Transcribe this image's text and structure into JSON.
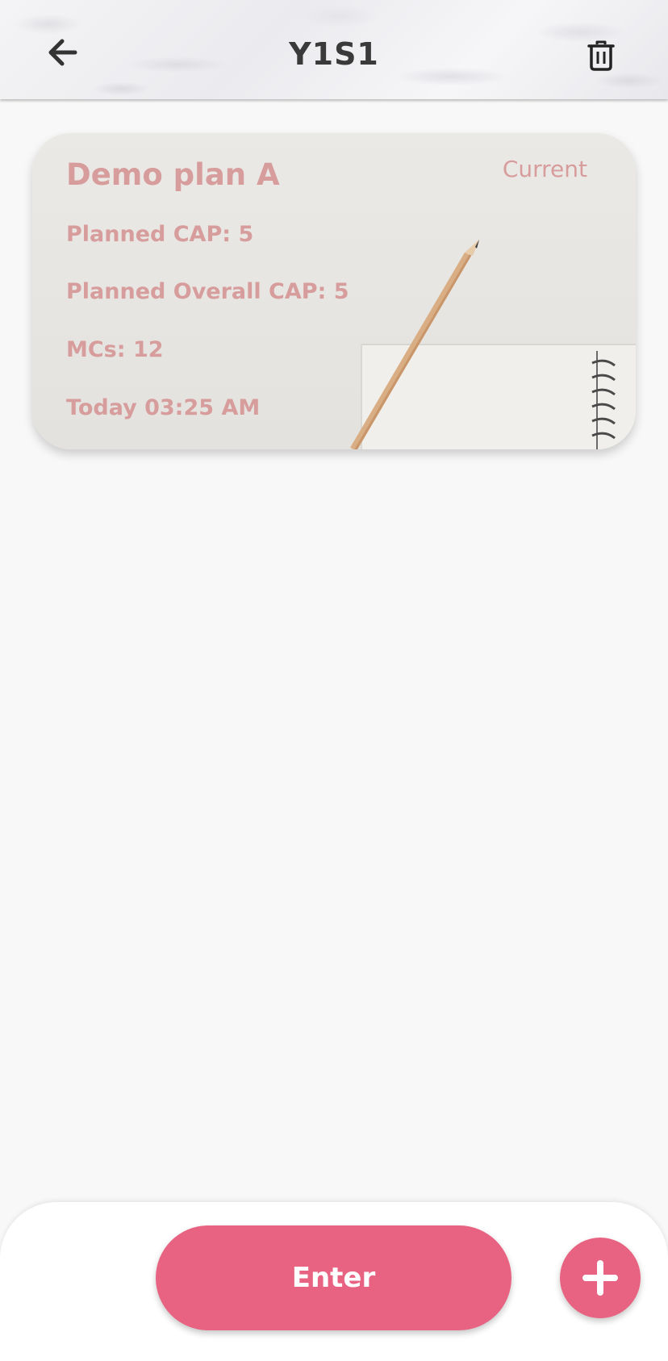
{
  "header": {
    "title": "Y1S1",
    "back_icon": "arrow-left-icon",
    "delete_icon": "trash-icon"
  },
  "plans": [
    {
      "name": "Demo plan A",
      "status": "Current",
      "planned_cap": "Planned CAP: 5",
      "planned_overall_cap": "Planned Overall CAP: 5",
      "mcs": "MCs: 12",
      "updated": "Today 03:25 AM"
    }
  ],
  "footer": {
    "enter_label": "Enter",
    "add_icon": "plus-icon"
  },
  "colors": {
    "accent": "#e86382",
    "card_text": "#d79c9c",
    "title_text": "#3a3a3a"
  }
}
